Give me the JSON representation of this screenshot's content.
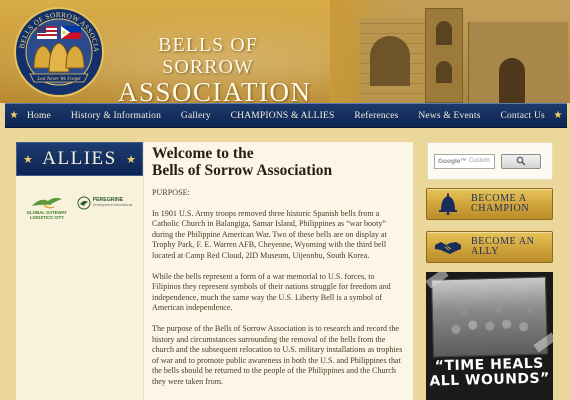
{
  "header": {
    "site_title_line1": "BELLS OF SORROW",
    "site_title_line2": "ASSOCIATION",
    "logo_arc_text": "BELLS OF SORROW ASSOCIATION",
    "logo_banner_text": "Lest Never We Forget"
  },
  "nav": {
    "items": [
      {
        "label": "Home"
      },
      {
        "label": "History & Information"
      },
      {
        "label": "Gallery"
      },
      {
        "label": "CHAMPIONS & ALLIES"
      },
      {
        "label": "References"
      },
      {
        "label": "News & Events"
      },
      {
        "label": "Contact Us"
      }
    ]
  },
  "sidebar": {
    "title": "ALLIES",
    "partners": [
      {
        "name": "GLOBAL GATEWAY LOGISTICS CITY",
        "line1": "GLOBAL GATEWAY",
        "line2": "LOGISTICS CITY"
      },
      {
        "name": "PEREGRINE",
        "sub": "Development International"
      }
    ]
  },
  "main": {
    "title_line1": "Welcome to the",
    "title_line2": "Bells of Sorrow Association",
    "purpose_label": "PURPOSE:",
    "paragraphs": [
      "In 1901 U.S. Army troops removed three historic Spanish bells from a Catholic Church in Balangiga, Samar Island, Philippines as “war booty” during the Philippine American War.  Two of these bells are on display at Trophy Park, F. E. Warren AFB, Cheyenne, Wyoming with the third bell located at Camp Red Cloud, 2ID Museum, Uijeonbu, South Korea.",
      "While the bells represent a form of a war memorial to U.S. forces, to Filipinos they represent symbols of their nations struggle for freedom and independence, much the same way the U.S. Liberty Bell is a symbol of American independence.",
      "The purpose of the Bells of Sorrow Association is to research and record the history and  circumstances surrounding the removal of the bells from the church and the subsequent relocation to U.S. military installations as trophies of war and to promote public awareness in both the U.S. and Philippines that the bells should be returned to the people of the Philippines and the Church they were taken from."
    ]
  },
  "search": {
    "placeholder": "Custom",
    "brand": "Google™"
  },
  "actions": {
    "champion_line1": "BECOME A",
    "champion_line2": "CHAMPION",
    "ally_line1": "BECOME AN",
    "ally_line2": "ALLY"
  },
  "promo": {
    "line1": "“TIME HEALS",
    "line2": "ALL WOUNDS”"
  },
  "colors": {
    "nav_blue": "#0e2450",
    "accent_gold": "#cfa33a",
    "star_gold": "#f2d16b"
  }
}
